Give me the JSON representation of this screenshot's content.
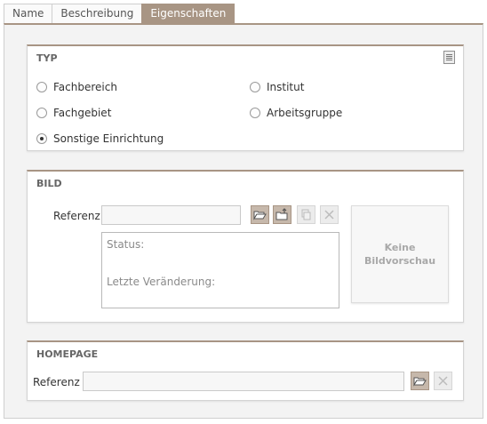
{
  "tabs": [
    {
      "label": "Name",
      "active": false
    },
    {
      "label": "Beschreibung",
      "active": false
    },
    {
      "label": "Eigenschaften",
      "active": true
    }
  ],
  "typ": {
    "title": "TYP",
    "icon": "document-icon",
    "options": [
      {
        "label": "Fachbereich",
        "checked": false
      },
      {
        "label": "Institut",
        "checked": false
      },
      {
        "label": "Fachgebiet",
        "checked": false
      },
      {
        "label": "Arbeitsgruppe",
        "checked": false
      },
      {
        "label": "Sonstige Einrichtung",
        "checked": true
      }
    ]
  },
  "bild": {
    "title": "BILD",
    "ref_label": "Referenz",
    "ref_value": "",
    "status_label": "Status:",
    "last_change_label": "Letzte Veränderung:",
    "preview_line1": "Keine",
    "preview_line2": "Bildvorschau",
    "buttons": [
      {
        "icon": "folder-open-icon",
        "enabled": true
      },
      {
        "icon": "folder-upload-icon",
        "enabled": true
      },
      {
        "icon": "copy-icon",
        "enabled": false
      },
      {
        "icon": "clear-icon",
        "enabled": false
      }
    ]
  },
  "homepage": {
    "title": "HOMEPAGE",
    "ref_label": "Referenz",
    "ref_value": "",
    "buttons": [
      {
        "icon": "folder-open-icon",
        "enabled": true
      },
      {
        "icon": "clear-icon",
        "enabled": false
      }
    ]
  },
  "colors": {
    "accent": "#a89584",
    "panel_bg": "#f3f3f3"
  }
}
